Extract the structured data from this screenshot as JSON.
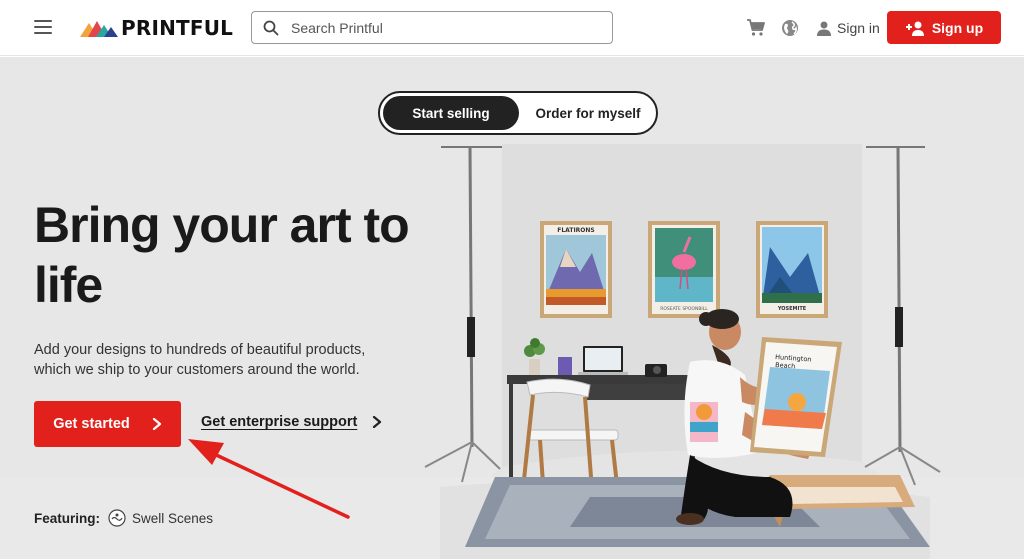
{
  "header": {
    "logo_text": "PRINTFUL",
    "search_placeholder": "Search Printful",
    "signin_label": "Sign in",
    "signup_label": "Sign up",
    "icons": [
      "menu-icon",
      "search-icon",
      "cart-icon",
      "globe-icon",
      "user-icon",
      "add-user-icon"
    ]
  },
  "hero": {
    "toggle": {
      "start_label": "Start selling",
      "order_label": "Order for myself",
      "selected": "Start selling"
    },
    "headline": "Bring your art to life",
    "subtext": "Add your designs to hundreds of beautiful products, which we ship to your customers around the world.",
    "cta_label": "Get started",
    "enterprise_label": "Get enterprise support",
    "featuring_label": "Featuring:",
    "featuring_brand": "Swell Scenes",
    "posters": {
      "p1": "FLATIRONS",
      "p2": "ROSEATE SPOONBILL",
      "p3": "YOSEMITE",
      "held": "Huntington Beach"
    }
  },
  "colors": {
    "brand_red": "#e2211c",
    "dark": "#222222",
    "hero_bg": "#e7e7e7"
  }
}
